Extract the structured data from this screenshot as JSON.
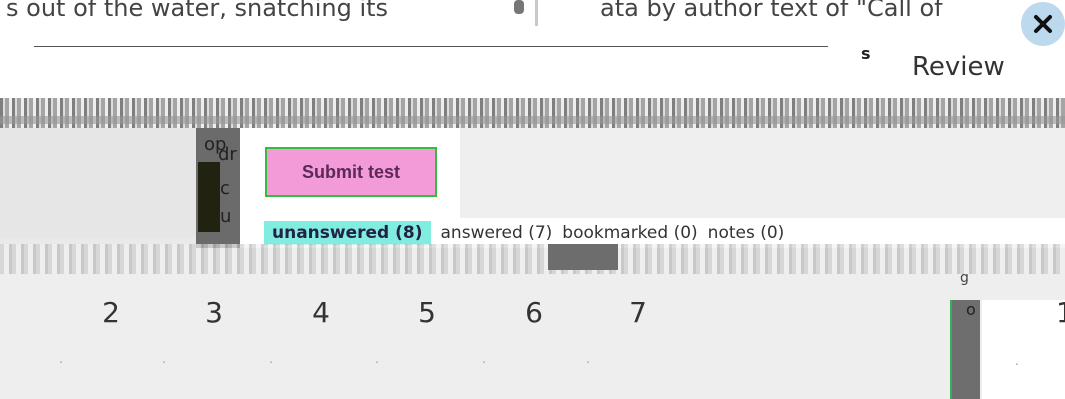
{
  "background_text": {
    "left": "s out of the water, snatching its",
    "right": "ata by author text of \"Call of"
  },
  "header": {
    "s_mark": "s",
    "review_label": "Review",
    "close_icon": "close-icon"
  },
  "left_stub": {
    "t1": "op",
    "t2": "dr",
    "t3": "c",
    "t4": "u"
  },
  "actions": {
    "submit_label": "Submit test"
  },
  "filters": {
    "unanswered": "unanswered (8)",
    "answered": "answered (7)",
    "bookmarked": "bookmarked (0)",
    "notes": "notes (0)"
  },
  "questions": [
    {
      "label": "2",
      "status": "."
    },
    {
      "label": "3",
      "status": "."
    },
    {
      "label": "4",
      "status": "."
    },
    {
      "label": "5",
      "status": "."
    },
    {
      "label": "6",
      "status": "."
    },
    {
      "label": "7",
      "status": "."
    }
  ],
  "nav": {
    "o_mark": "o",
    "next_num": "1",
    "g_mark": "g",
    "small_mark": "."
  },
  "colors": {
    "submit_bg": "#f39bd9",
    "submit_border": "#30c040",
    "unanswered_chip": "#80ede0",
    "close_bg": "#bcd9ee"
  }
}
